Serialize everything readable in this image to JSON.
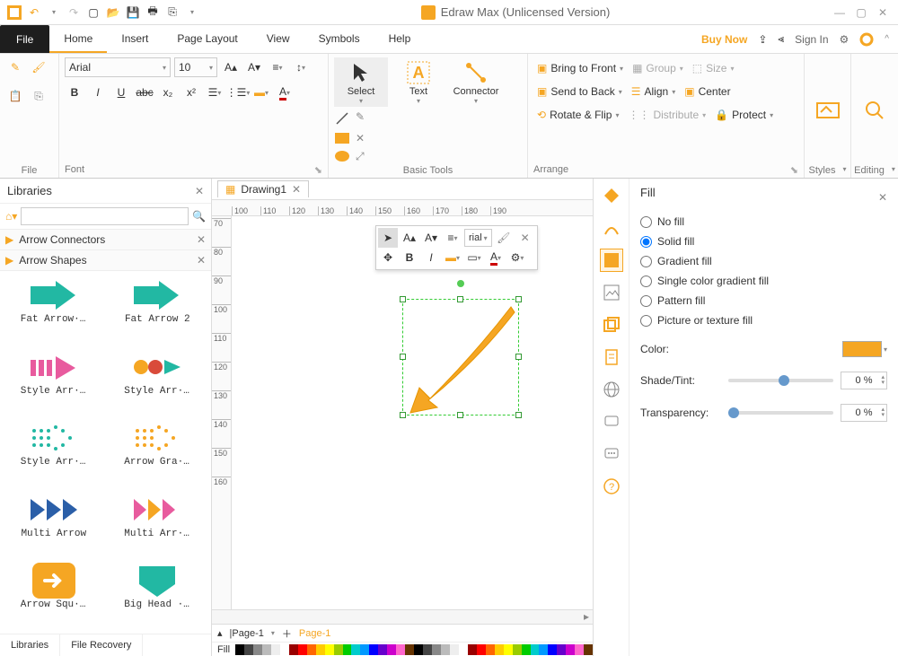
{
  "title": "Edraw Max (Unlicensed Version)",
  "menu": {
    "file": "File",
    "tabs": [
      "Home",
      "Insert",
      "Page Layout",
      "View",
      "Symbols",
      "Help"
    ],
    "active": "Home",
    "buy": "Buy Now",
    "signin": "Sign In"
  },
  "ribbon": {
    "file": "File",
    "font": {
      "label": "Font",
      "family": "Arial",
      "size": "10"
    },
    "tools": {
      "label": "Basic Tools",
      "select": "Select",
      "text": "Text",
      "connector": "Connector"
    },
    "arrange": {
      "label": "Arrange",
      "front": "Bring to Front",
      "back": "Send to Back",
      "rotate": "Rotate & Flip",
      "group": "Group",
      "align": "Align",
      "distribute": "Distribute",
      "size": "Size",
      "center": "Center",
      "protect": "Protect"
    },
    "styles": "Styles",
    "editing": "Editing"
  },
  "libraries": {
    "title": "Libraries",
    "sections": [
      "Arrow Connectors",
      "Arrow Shapes"
    ],
    "shapes": [
      "Fat Arrow···",
      "Fat Arrow 2",
      "Style Arr···",
      "Style Arr···",
      "Style Arr···",
      "Arrow Gra···",
      "Multi Arrow",
      "Multi Arr···",
      "Arrow Squ···",
      "Big Head ···"
    ],
    "tabs": [
      "Libraries",
      "File Recovery"
    ]
  },
  "doc": {
    "tab": "Drawing1",
    "page_tab": "|Page-1",
    "page_active": "Page-1",
    "fill_lbl": "Fill"
  },
  "ruler": {
    "h": [
      "100",
      "110",
      "120",
      "130",
      "140",
      "150",
      "160",
      "170",
      "180",
      "190"
    ],
    "v": [
      "70",
      "80",
      "90",
      "100",
      "110",
      "120",
      "130",
      "140",
      "150",
      "160"
    ]
  },
  "float": {
    "font": "rial"
  },
  "fill": {
    "title": "Fill",
    "opts": [
      "No fill",
      "Solid fill",
      "Gradient fill",
      "Single color gradient fill",
      "Pattern fill",
      "Picture or texture fill"
    ],
    "selected": "Solid fill",
    "color_lbl": "Color:",
    "shade_lbl": "Shade/Tint:",
    "trans_lbl": "Transparency:",
    "shade_val": "0 %",
    "trans_val": "0 %",
    "color": "#f5a623"
  },
  "palette": [
    "#000",
    "#444",
    "#888",
    "#bbb",
    "#eee",
    "#fff",
    "#900",
    "#f00",
    "#f60",
    "#fc0",
    "#ff0",
    "#9c0",
    "#0c0",
    "#0cc",
    "#09f",
    "#00f",
    "#60c",
    "#c0c",
    "#f6c",
    "#630"
  ]
}
